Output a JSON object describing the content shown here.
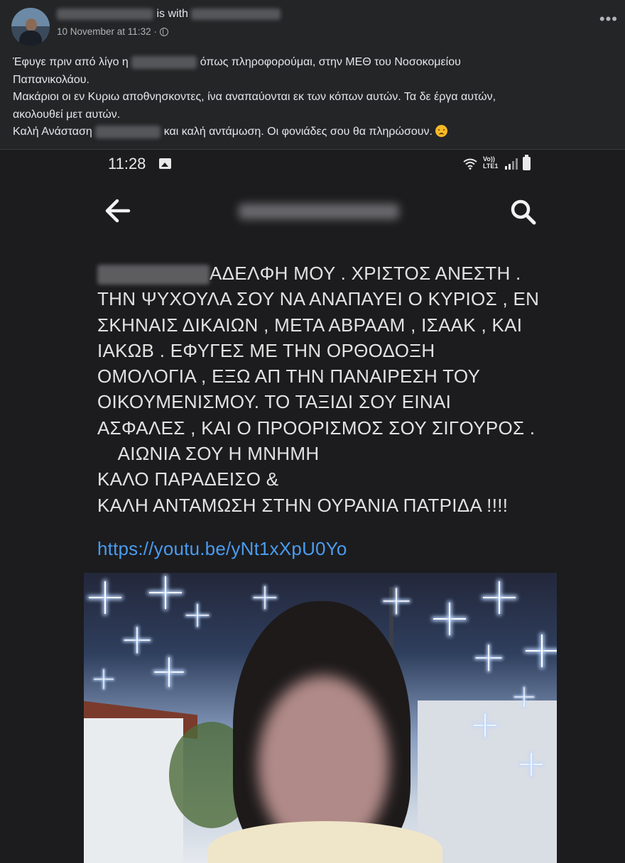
{
  "post": {
    "with_label": "is with",
    "timestamp": "10 November at 11:32 ·",
    "more_label": "•••",
    "text_lines": [
      [
        "Έφυγε  πριν από λίγο η",
        "όπως πληροφορούμαι,  στην ΜΕΘ  του Νοσοκομείου"
      ],
      [
        "Παπανικολάου."
      ],
      [
        "Μακάριοι οι εν Κυριω αποθνησκοντες, ίνα αναπαύονται εκ των κόπων αυτών. Τα δε έργα αυτών,"
      ],
      [
        "ακολουθεί μετ αυτών."
      ],
      [
        "Καλή Ανάσταση",
        "και καλή αντάμωση. Οι φονιάδες σου θα πληρώσουν."
      ]
    ]
  },
  "phone": {
    "time": "11:28",
    "network_label": "Vo)) LTE1",
    "icons": [
      "gallery-icon",
      "wifi-icon",
      "signal-icon",
      "battery-icon",
      "back-icon",
      "search-icon"
    ]
  },
  "message": {
    "lines": [
      "ΑΔΕΛΦΗ ΜΟΥ . ΧΡΙΣΤΟΣ ΑΝΕΣΤΗ .",
      "ΤΗΝ ΨΥΧΟΥΛΑ ΣΟΥ ΝΑ ΑΝΑΠΑΥΕΙ Ο ΚΥΡΙΟΣ , ΕΝ",
      "ΣΚΗΝΑΙΣ ΔΙΚΑΙΩΝ , ΜΕΤΑ ΑΒΡΑΑΜ , ΙΣΑΑΚ , ΚΑΙ",
      "ΙΑΚΩΒ . ΕΦΥΓΕΣ ΜΕ ΤΗΝ ΟΡΘΟΔΟΞΗ",
      "ΟΜΟΛΟΓΙΑ  , ΕΞΩ ΑΠ ΤΗΝ ΠΑΝΑΙΡΕΣΗ ΤΟΥ",
      "ΟΙΚΟΥΜΕΝΙΣΜΟΥ. ΤΟ ΤΑΞΙΔΙ ΣΟΥ ΕΙΝΑΙ",
      "ΑΣΦΑΛΕΣ , ΚΑΙ Ο ΠΡΟΟΡΙΣΜΟΣ ΣΟΥ ΣΙΓΟΥΡΟΣ .",
      "    ΑΙΩΝΙΑ ΣΟΥ Η ΜΝΗΜΗ",
      "ΚΑΛΟ ΠΑΡΑΔΕΙΣΟ &",
      "ΚΑΛΗ ΑΝΤΑΜΩΣΗ ΣΤΗΝ ΟΥΡΑΝΙΑ  ΠΑΤΡΙΔΑ  !!!!"
    ],
    "link": "https://youtu.be/yNt1xXpU0Yo"
  },
  "colors": {
    "background": "#242526",
    "link": "#4a9bf0"
  }
}
